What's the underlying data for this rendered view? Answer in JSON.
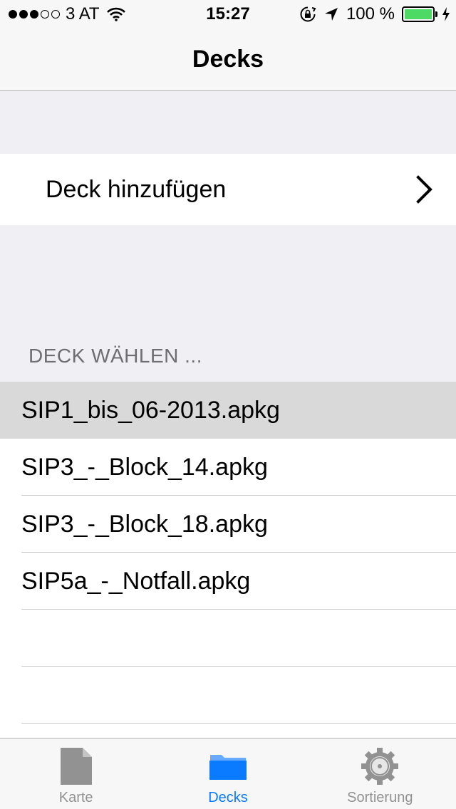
{
  "status_bar": {
    "carrier": "3 AT",
    "time": "15:27",
    "battery": "100 %",
    "battery_level": 1.0
  },
  "nav": {
    "title": "Decks"
  },
  "add_deck": {
    "label": "Deck hinzufügen",
    "icon": "chevron-right-icon"
  },
  "deck_section": {
    "header": "DECK WÄHLEN ...",
    "items": [
      {
        "label": "SIP1_bis_06-2013.apkg",
        "selected": true
      },
      {
        "label": "SIP3_-_Block_14.apkg",
        "selected": false
      },
      {
        "label": "SIP3_-_Block_18.apkg",
        "selected": false
      },
      {
        "label": "SIP5a_-_Notfall.apkg",
        "selected": false
      }
    ]
  },
  "tab_bar": {
    "tabs": [
      {
        "label": "Karte",
        "icon": "document-icon",
        "active": false
      },
      {
        "label": "Decks",
        "icon": "folder-icon",
        "active": true
      },
      {
        "label": "Sortierung",
        "icon": "gear-icon",
        "active": false
      }
    ]
  },
  "colors": {
    "accent": "#0a7aff",
    "battery": "#4cd964",
    "selected_row": "#d9d9d9",
    "inactive_tab": "#929292"
  }
}
